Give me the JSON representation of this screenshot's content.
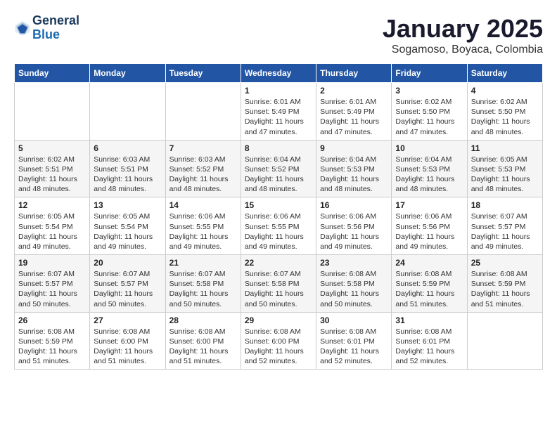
{
  "header": {
    "logo_line1": "General",
    "logo_line2": "Blue",
    "month": "January 2025",
    "location": "Sogamoso, Boyaca, Colombia"
  },
  "days_of_week": [
    "Sunday",
    "Monday",
    "Tuesday",
    "Wednesday",
    "Thursday",
    "Friday",
    "Saturday"
  ],
  "weeks": [
    [
      {
        "day": "",
        "content": ""
      },
      {
        "day": "",
        "content": ""
      },
      {
        "day": "",
        "content": ""
      },
      {
        "day": "1",
        "content": "Sunrise: 6:01 AM\nSunset: 5:49 PM\nDaylight: 11 hours\nand 47 minutes."
      },
      {
        "day": "2",
        "content": "Sunrise: 6:01 AM\nSunset: 5:49 PM\nDaylight: 11 hours\nand 47 minutes."
      },
      {
        "day": "3",
        "content": "Sunrise: 6:02 AM\nSunset: 5:50 PM\nDaylight: 11 hours\nand 47 minutes."
      },
      {
        "day": "4",
        "content": "Sunrise: 6:02 AM\nSunset: 5:50 PM\nDaylight: 11 hours\nand 48 minutes."
      }
    ],
    [
      {
        "day": "5",
        "content": "Sunrise: 6:02 AM\nSunset: 5:51 PM\nDaylight: 11 hours\nand 48 minutes."
      },
      {
        "day": "6",
        "content": "Sunrise: 6:03 AM\nSunset: 5:51 PM\nDaylight: 11 hours\nand 48 minutes."
      },
      {
        "day": "7",
        "content": "Sunrise: 6:03 AM\nSunset: 5:52 PM\nDaylight: 11 hours\nand 48 minutes."
      },
      {
        "day": "8",
        "content": "Sunrise: 6:04 AM\nSunset: 5:52 PM\nDaylight: 11 hours\nand 48 minutes."
      },
      {
        "day": "9",
        "content": "Sunrise: 6:04 AM\nSunset: 5:53 PM\nDaylight: 11 hours\nand 48 minutes."
      },
      {
        "day": "10",
        "content": "Sunrise: 6:04 AM\nSunset: 5:53 PM\nDaylight: 11 hours\nand 48 minutes."
      },
      {
        "day": "11",
        "content": "Sunrise: 6:05 AM\nSunset: 5:53 PM\nDaylight: 11 hours\nand 48 minutes."
      }
    ],
    [
      {
        "day": "12",
        "content": "Sunrise: 6:05 AM\nSunset: 5:54 PM\nDaylight: 11 hours\nand 49 minutes."
      },
      {
        "day": "13",
        "content": "Sunrise: 6:05 AM\nSunset: 5:54 PM\nDaylight: 11 hours\nand 49 minutes."
      },
      {
        "day": "14",
        "content": "Sunrise: 6:06 AM\nSunset: 5:55 PM\nDaylight: 11 hours\nand 49 minutes."
      },
      {
        "day": "15",
        "content": "Sunrise: 6:06 AM\nSunset: 5:55 PM\nDaylight: 11 hours\nand 49 minutes."
      },
      {
        "day": "16",
        "content": "Sunrise: 6:06 AM\nSunset: 5:56 PM\nDaylight: 11 hours\nand 49 minutes."
      },
      {
        "day": "17",
        "content": "Sunrise: 6:06 AM\nSunset: 5:56 PM\nDaylight: 11 hours\nand 49 minutes."
      },
      {
        "day": "18",
        "content": "Sunrise: 6:07 AM\nSunset: 5:57 PM\nDaylight: 11 hours\nand 49 minutes."
      }
    ],
    [
      {
        "day": "19",
        "content": "Sunrise: 6:07 AM\nSunset: 5:57 PM\nDaylight: 11 hours\nand 50 minutes."
      },
      {
        "day": "20",
        "content": "Sunrise: 6:07 AM\nSunset: 5:57 PM\nDaylight: 11 hours\nand 50 minutes."
      },
      {
        "day": "21",
        "content": "Sunrise: 6:07 AM\nSunset: 5:58 PM\nDaylight: 11 hours\nand 50 minutes."
      },
      {
        "day": "22",
        "content": "Sunrise: 6:07 AM\nSunset: 5:58 PM\nDaylight: 11 hours\nand 50 minutes."
      },
      {
        "day": "23",
        "content": "Sunrise: 6:08 AM\nSunset: 5:58 PM\nDaylight: 11 hours\nand 50 minutes."
      },
      {
        "day": "24",
        "content": "Sunrise: 6:08 AM\nSunset: 5:59 PM\nDaylight: 11 hours\nand 51 minutes."
      },
      {
        "day": "25",
        "content": "Sunrise: 6:08 AM\nSunset: 5:59 PM\nDaylight: 11 hours\nand 51 minutes."
      }
    ],
    [
      {
        "day": "26",
        "content": "Sunrise: 6:08 AM\nSunset: 5:59 PM\nDaylight: 11 hours\nand 51 minutes."
      },
      {
        "day": "27",
        "content": "Sunrise: 6:08 AM\nSunset: 6:00 PM\nDaylight: 11 hours\nand 51 minutes."
      },
      {
        "day": "28",
        "content": "Sunrise: 6:08 AM\nSunset: 6:00 PM\nDaylight: 11 hours\nand 51 minutes."
      },
      {
        "day": "29",
        "content": "Sunrise: 6:08 AM\nSunset: 6:00 PM\nDaylight: 11 hours\nand 52 minutes."
      },
      {
        "day": "30",
        "content": "Sunrise: 6:08 AM\nSunset: 6:01 PM\nDaylight: 11 hours\nand 52 minutes."
      },
      {
        "day": "31",
        "content": "Sunrise: 6:08 AM\nSunset: 6:01 PM\nDaylight: 11 hours\nand 52 minutes."
      },
      {
        "day": "",
        "content": ""
      }
    ]
  ]
}
